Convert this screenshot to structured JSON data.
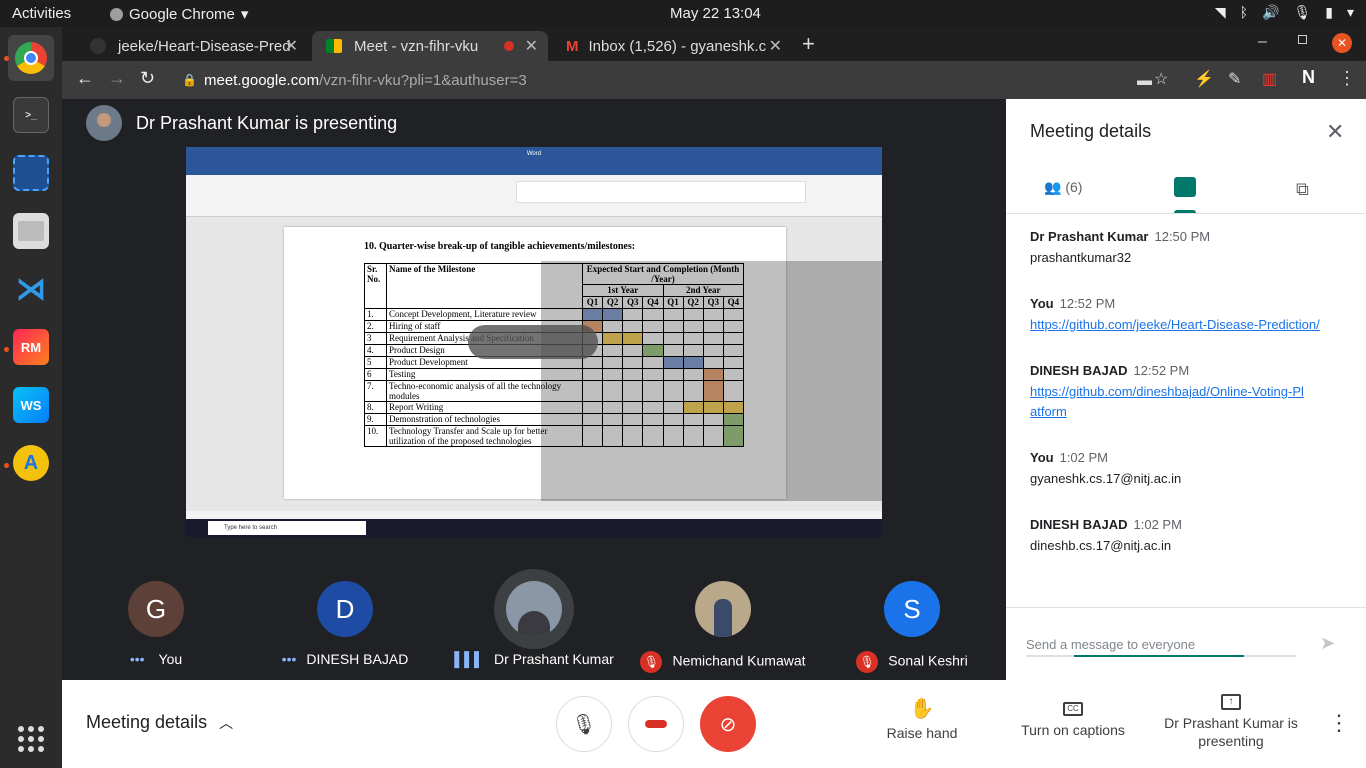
{
  "system": {
    "activities": "Activities",
    "app": "Google Chrome",
    "clock": "May 22  13:04"
  },
  "dock": {
    "rm_label": "RM",
    "ws_label": "WS"
  },
  "tabs": [
    {
      "label": "jeeke/Heart-Disease-Pred"
    },
    {
      "label": "Meet - vzn-fihr-vku"
    },
    {
      "label": "Inbox (1,526) - gyaneshk.c"
    }
  ],
  "url": {
    "host": "meet.google.com",
    "path": "/vzn-fihr-vku?pli=1&authuser=3"
  },
  "presenting_banner": "Dr Prashant Kumar is presenting",
  "document": {
    "heading": "10. Quarter-wise break-up of tangible achievements/milestones:",
    "col_sr": "Sr. No.",
    "col_name": "Name of the Milestone",
    "col_expected": "Expected Start and Completion (Month /Year)",
    "year1": "1st Year",
    "year2": "2nd Year",
    "quarters": [
      "Q1",
      "Q2",
      "Q3",
      "Q4",
      "Q1",
      "Q2",
      "Q3",
      "Q4"
    ],
    "rows": [
      {
        "sr": "1.",
        "name": "Concept Development, Literature review"
      },
      {
        "sr": "2.",
        "name": "Hiring of staff"
      },
      {
        "sr": "3",
        "name": "Requirement Analysis and Specification"
      },
      {
        "sr": "4.",
        "name": "Product Design"
      },
      {
        "sr": "5",
        "name": "Product Development"
      },
      {
        "sr": "6",
        "name": "Testing"
      },
      {
        "sr": "7.",
        "name": "Techno-economic analysis of all the technology modules"
      },
      {
        "sr": "8.",
        "name": "Report Writing"
      },
      {
        "sr": "9.",
        "name": "Demonstration of technologies"
      },
      {
        "sr": "10.",
        "name": "Technology Transfer and Scale up for better utilization of the proposed technologies"
      }
    ],
    "word_title": "Word",
    "search_bar": "Type here to search"
  },
  "participants": [
    {
      "initial": "G",
      "name": "You",
      "color": "#5d4037"
    },
    {
      "initial": "D",
      "name": "DINESH BAJAD",
      "color": "#1e4ba3"
    },
    {
      "initial": "",
      "name": "Dr Prashant Kumar",
      "color": "#555"
    },
    {
      "initial": "",
      "name": "Nemichand Kumawat",
      "color": "#777"
    },
    {
      "initial": "S",
      "name": "Sonal Keshri",
      "color": "#1a73e8"
    }
  ],
  "panel": {
    "title": "Meeting details",
    "people_count": "(6)",
    "messages": [
      {
        "who": "Dr Prashant Kumar",
        "time": "12:50 PM",
        "text": "prashantkumar32"
      },
      {
        "who": "You",
        "time": "12:52 PM",
        "link": "https://github.com/jeeke/Heart-Disease-Prediction/"
      },
      {
        "who": "DINESH BAJAD",
        "time": "12:52 PM",
        "link": "https://github.com/dineshbajad/Online-Voting-Platform"
      },
      {
        "who": "You",
        "time": "1:02 PM",
        "text": "gyaneshk.cs.17@nitj.ac.in"
      },
      {
        "who": "DINESH BAJAD",
        "time": "1:02 PM",
        "text": "dineshb.cs.17@nitj.ac.in"
      }
    ],
    "input_placeholder": "Send a message to everyone"
  },
  "bottom": {
    "details": "Meeting details",
    "raise_hand": "Raise hand",
    "captions": "Turn on captions",
    "presenting": "Dr Prashant Kumar is presenting"
  }
}
